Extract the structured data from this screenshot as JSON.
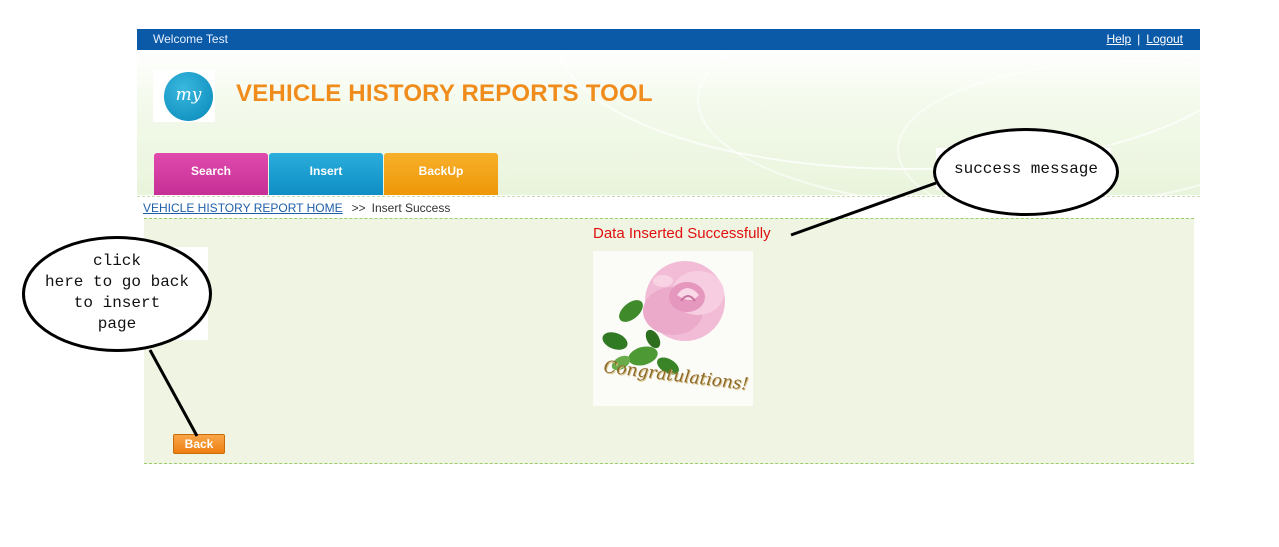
{
  "topbar": {
    "welcome": "Welcome Test",
    "help_link": "Help",
    "separator": "|",
    "logout_link": "Logout",
    "bg_color": "#0a5aa8"
  },
  "header": {
    "logo_text": "my",
    "title": "VEHICLE HISTORY REPORTS TOOL",
    "title_color": "#f08c1c"
  },
  "tabs": [
    {
      "label": "Search",
      "color": "#c62f95"
    },
    {
      "label": "Insert",
      "color": "#0e8ec4"
    },
    {
      "label": "BackUp",
      "color": "#ee9708"
    }
  ],
  "breadcrumb": {
    "home": "VEHICLE HISTORY REPORT HOME",
    "separator": ">>",
    "current": "Insert Success"
  },
  "main": {
    "success_message": "Data Inserted Successfully",
    "image_caption": "Congratulations!",
    "back_button": "Back"
  },
  "annotations": {
    "left_note_lines": [
      "click",
      "here to go back",
      "to insert",
      "page"
    ],
    "right_note": "success message"
  }
}
